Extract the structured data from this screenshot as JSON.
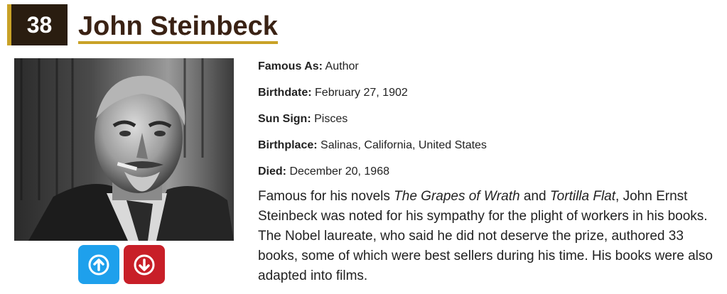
{
  "person": {
    "rank": "38",
    "name": "John Steinbeck"
  },
  "facts": [
    {
      "label": "Famous As:",
      "value": "Author"
    },
    {
      "label": "Birthdate:",
      "value": "February 27, 1902"
    },
    {
      "label": "Sun Sign:",
      "value": "Pisces"
    },
    {
      "label": "Birthplace:",
      "value": "Salinas, California, United States"
    },
    {
      "label": "Died:",
      "value": "December 20, 1968"
    }
  ],
  "bio": {
    "part1": "Famous for his novels ",
    "title1": "The Grapes of Wrath",
    "part2": " and ",
    "title2": "Tortilla Flat",
    "part3": ", John Ernst Steinbeck was noted for his sympathy for the plight of workers in his books. The Nobel laureate, who said he did not deserve the prize, authored 33 books, some of which were best sellers during his time. His books were also adapted into films."
  },
  "colors": {
    "accent": "#c9a227",
    "rank_bg": "#2a1d10",
    "name_color": "#3a2214",
    "upvote": "#1ea0ec",
    "downvote": "#c81f28"
  },
  "icons": {
    "upvote": "arrow-up-circle-icon",
    "downvote": "arrow-down-circle-icon"
  }
}
